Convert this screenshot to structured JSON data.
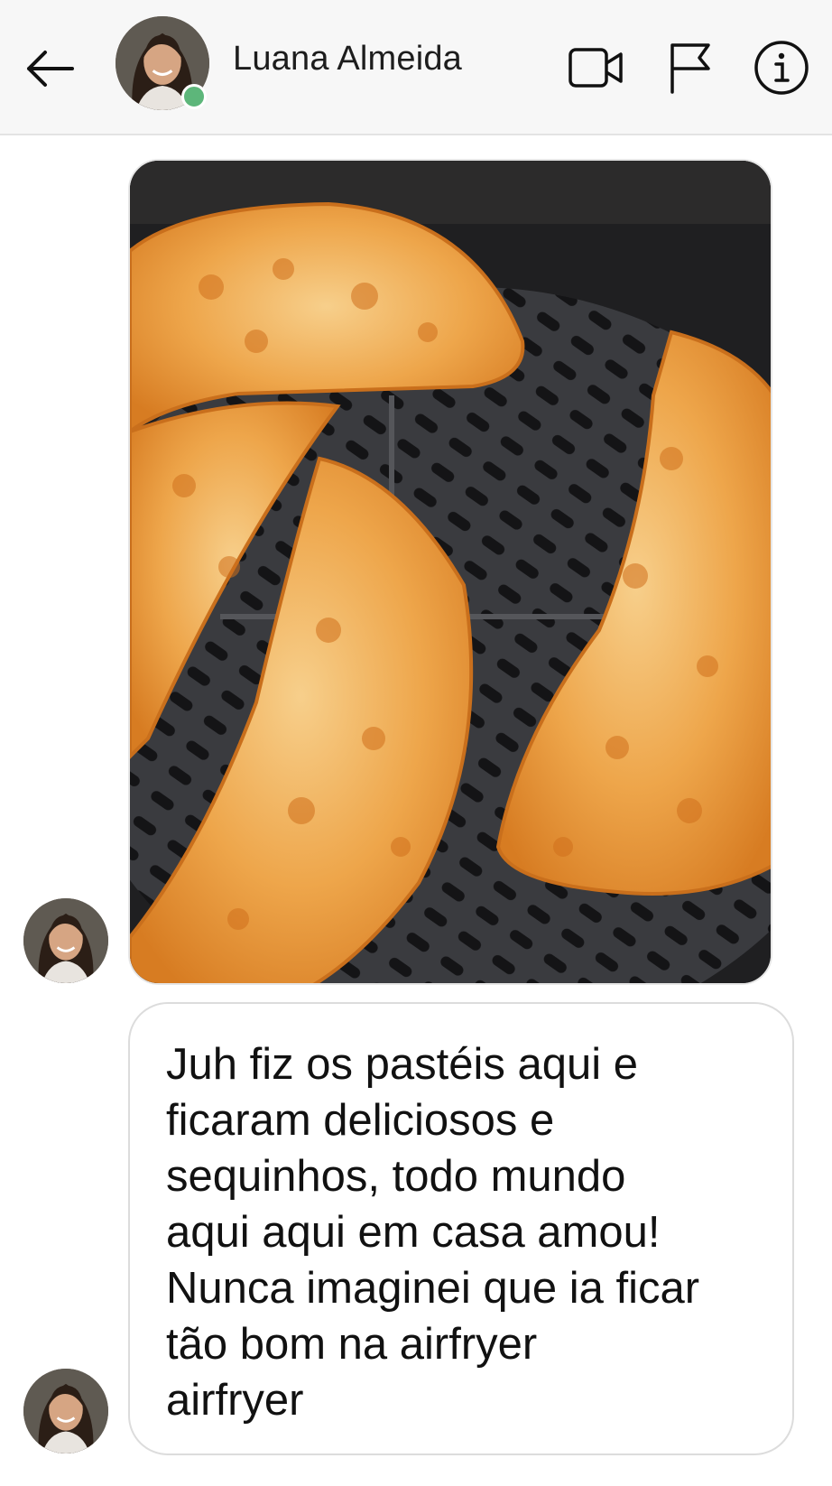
{
  "header": {
    "contact_name": "Luana Almeida",
    "online": true,
    "icons": {
      "back": "arrow-left-icon",
      "video": "video-camera-icon",
      "report": "flag-icon",
      "info": "info-icon"
    }
  },
  "messages": [
    {
      "type": "image",
      "sender": "Luana Almeida",
      "image_subject": "pastéis in air fryer basket"
    },
    {
      "type": "text",
      "sender": "Luana Almeida",
      "text": "Juh fiz os pastéis aqui e\nficaram deliciosos e\nsequinhos, todo mundo\naqui aqui em casa amou!\nNunca imaginei que ia ficar\ntão bom na airfryer\nairfryer"
    }
  ],
  "colors": {
    "online_indicator": "#5db67a",
    "header_bg": "#f7f7f7",
    "bubble_border": "#dcdcdc",
    "text": "#111111"
  }
}
